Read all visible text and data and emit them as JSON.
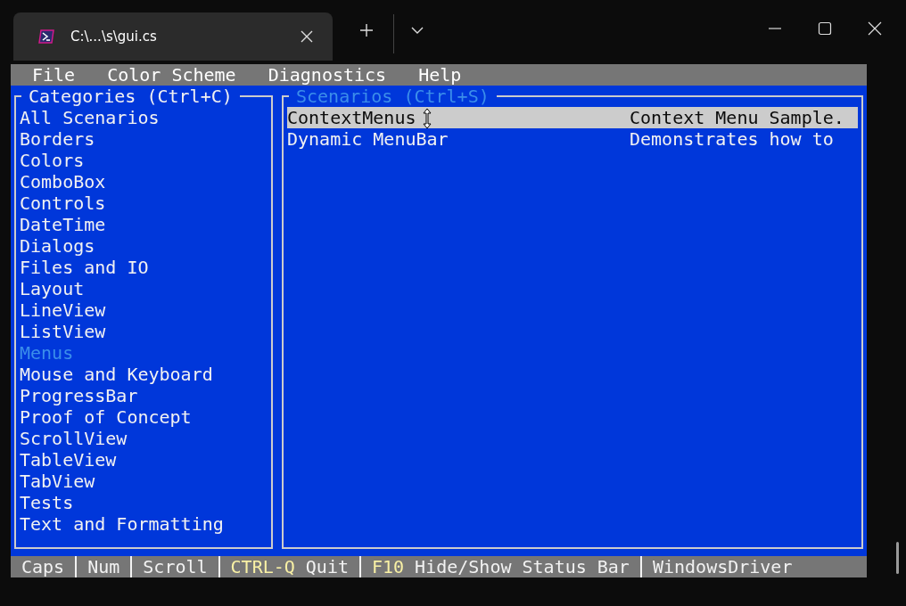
{
  "window": {
    "tab_title": "C:\\...\\s\\gui.cs"
  },
  "menu_bar": [
    "File",
    "Color Scheme",
    "Diagnostics",
    "Help"
  ],
  "categories": {
    "title": "Categories (Ctrl+C)",
    "focused": false,
    "items": [
      {
        "label": "All Scenarios",
        "selected": false
      },
      {
        "label": "Borders",
        "selected": false
      },
      {
        "label": "Colors",
        "selected": false
      },
      {
        "label": "ComboBox",
        "selected": false
      },
      {
        "label": "Controls",
        "selected": false
      },
      {
        "label": "DateTime",
        "selected": false
      },
      {
        "label": "Dialogs",
        "selected": false
      },
      {
        "label": "Files and IO",
        "selected": false
      },
      {
        "label": "Layout",
        "selected": false
      },
      {
        "label": "LineView",
        "selected": false
      },
      {
        "label": "ListView",
        "selected": false
      },
      {
        "label": "Menus",
        "selected": true
      },
      {
        "label": "Mouse and Keyboard",
        "selected": false
      },
      {
        "label": "ProgressBar",
        "selected": false
      },
      {
        "label": "Proof of Concept",
        "selected": false
      },
      {
        "label": "ScrollView",
        "selected": false
      },
      {
        "label": "TableView",
        "selected": false
      },
      {
        "label": "TabView",
        "selected": false
      },
      {
        "label": "Tests",
        "selected": false
      },
      {
        "label": "Text and Formatting",
        "selected": false
      }
    ]
  },
  "scenarios": {
    "title": "Scenarios (Ctrl+S)",
    "focused": true,
    "rows": [
      {
        "name": "ContextMenus",
        "description": "Context Menu Sample.",
        "selected": true
      },
      {
        "name": "Dynamic MenuBar",
        "description": "Demonstrates how to",
        "selected": false
      }
    ]
  },
  "status_bar": [
    {
      "label": "Caps"
    },
    {
      "label": "Num"
    },
    {
      "label": "Scroll"
    },
    {
      "key": "CTRL-Q",
      "label": "Quit"
    },
    {
      "key": "F10",
      "label": "Hide/Show Status Bar"
    },
    {
      "label": "WindowsDriver"
    }
  ]
}
